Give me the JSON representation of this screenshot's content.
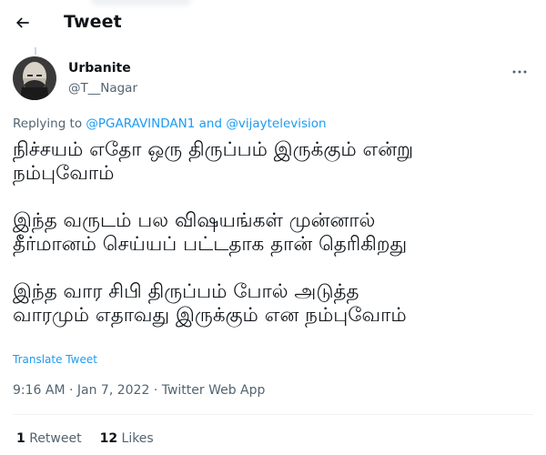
{
  "header": {
    "title": "Tweet",
    "back_icon": "arrow-left-icon"
  },
  "author": {
    "display_name": "Urbanite",
    "handle": "@T__Nagar",
    "more_icon": "more-horizontal-icon"
  },
  "reply": {
    "prefix": "Replying to ",
    "user1": "@PGARAVINDAN1",
    "joiner": " and ",
    "user2": "@vijaytelevision"
  },
  "tweet": {
    "paragraphs": [
      {
        "line1": "நிச்சயம் எதோ ஒரு திருப்பம் இருக்கும் என்று",
        "line2": "நம்புவோம்"
      },
      {
        "line1": "இந்த வருடம் பல விஷயங்கள் முன்னால்",
        "line2": "தீர்மானம் செய்யப் பட்டதாக தான் தெரிகிறது"
      },
      {
        "line1": "இந்த வார சிபி திருப்பம் போல் அடுத்த",
        "line2": "வாரமும் எதாவது இருக்கும் என நம்புவோம்"
      }
    ],
    "translate_label": "Translate Tweet",
    "timestamp": "9:16 AM · Jan 7, 2022 · Twitter Web App"
  },
  "stats": {
    "retweets_count": "1",
    "retweets_label": " Retweet",
    "likes_count": "12",
    "likes_label": " Likes"
  },
  "colors": {
    "accent": "#1d9bf0",
    "text": "#0f1419",
    "secondary": "#536471"
  }
}
